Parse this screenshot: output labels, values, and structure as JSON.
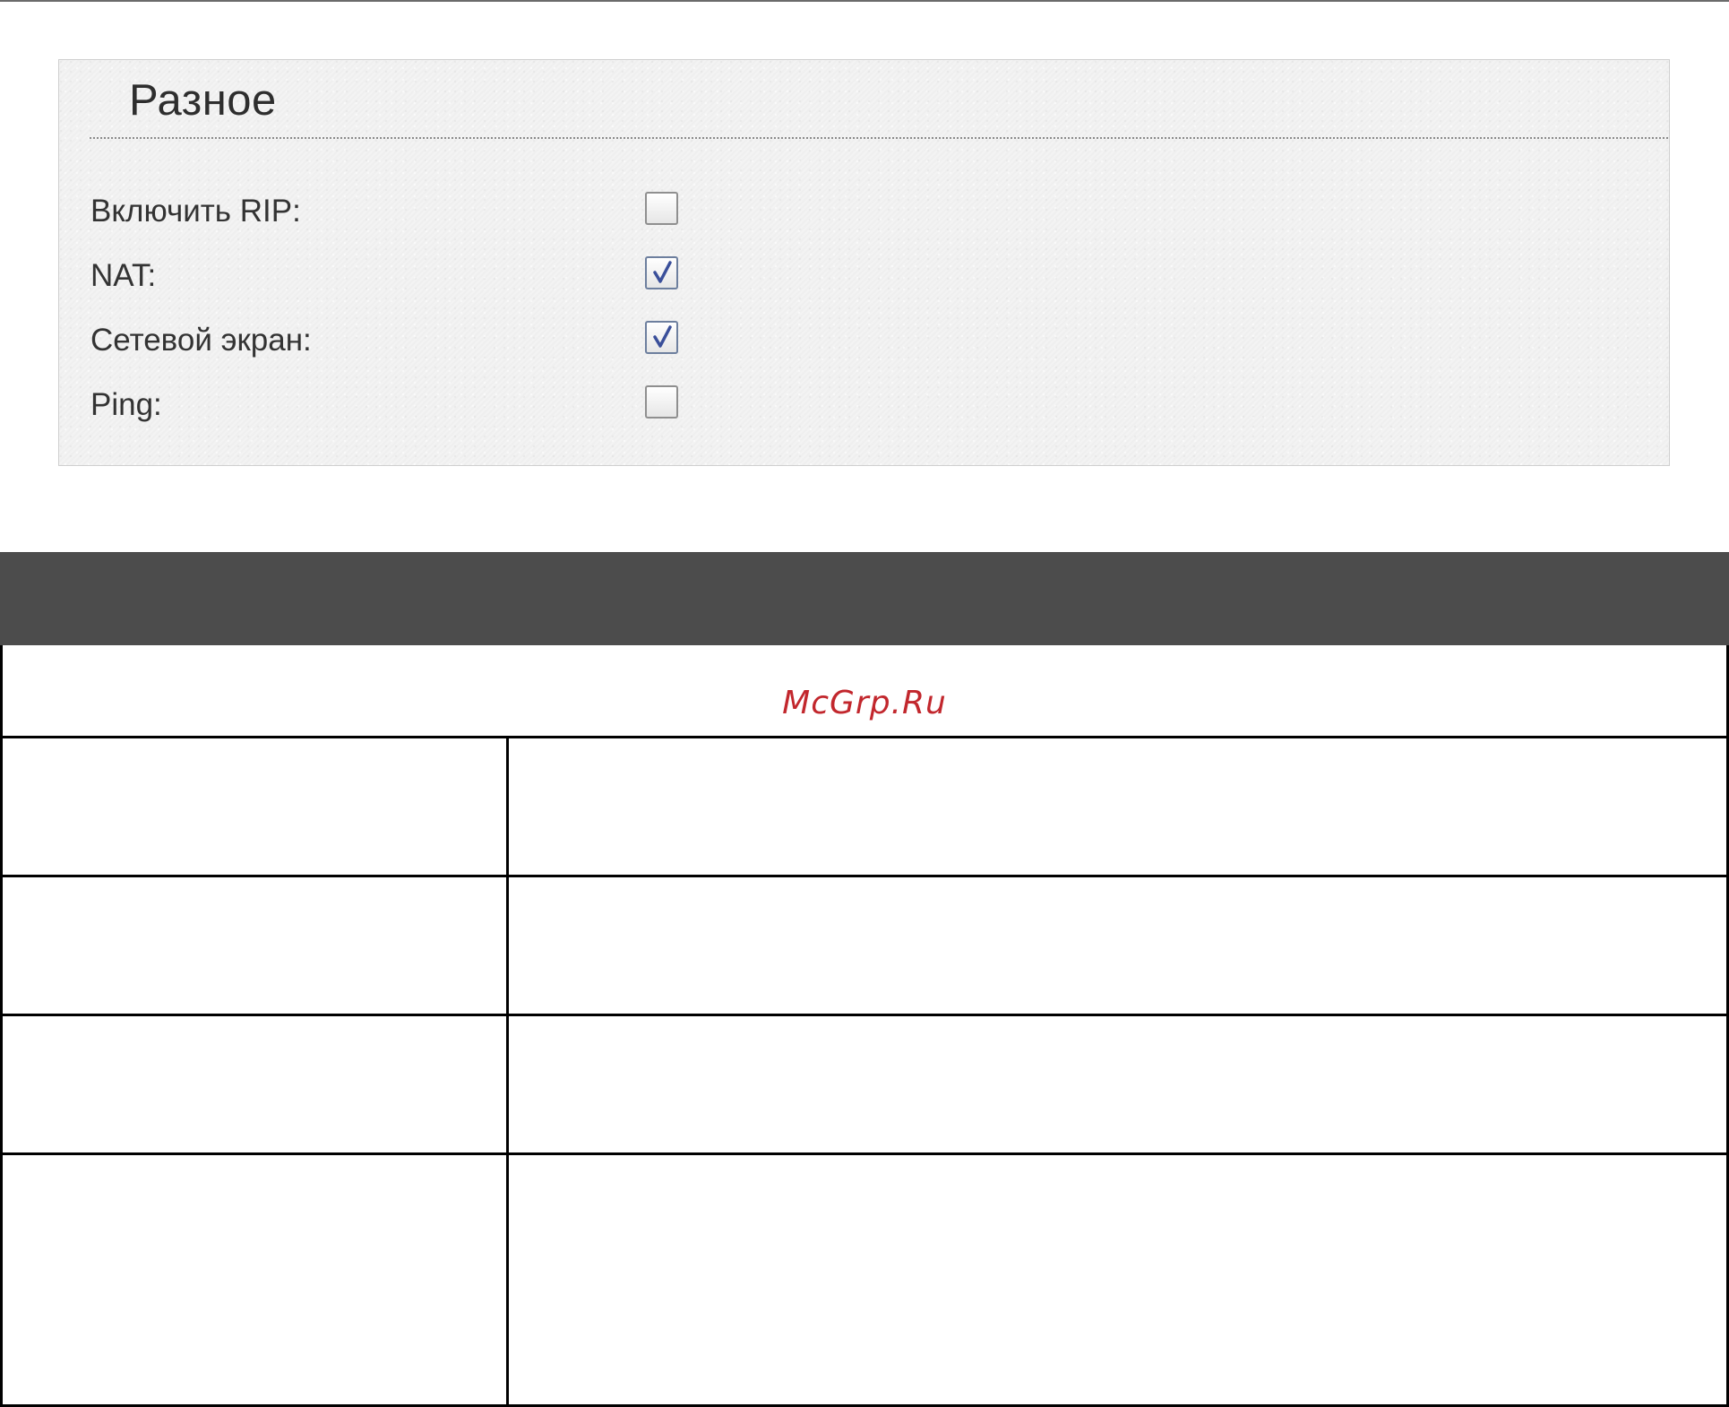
{
  "panel": {
    "title": "Разное",
    "rows": [
      {
        "label": "Включить RIP:",
        "checked": false
      },
      {
        "label": "NAT:",
        "checked": true
      },
      {
        "label": "Сетевой экран:",
        "checked": true
      },
      {
        "label": "Ping:",
        "checked": false
      }
    ]
  },
  "watermark": "McGrp.Ru",
  "colors": {
    "panel_bg": "#efefef",
    "dark_bar": "#4c4c4c",
    "check_mark": "#3a4f9a",
    "watermark": "#c2272d"
  }
}
